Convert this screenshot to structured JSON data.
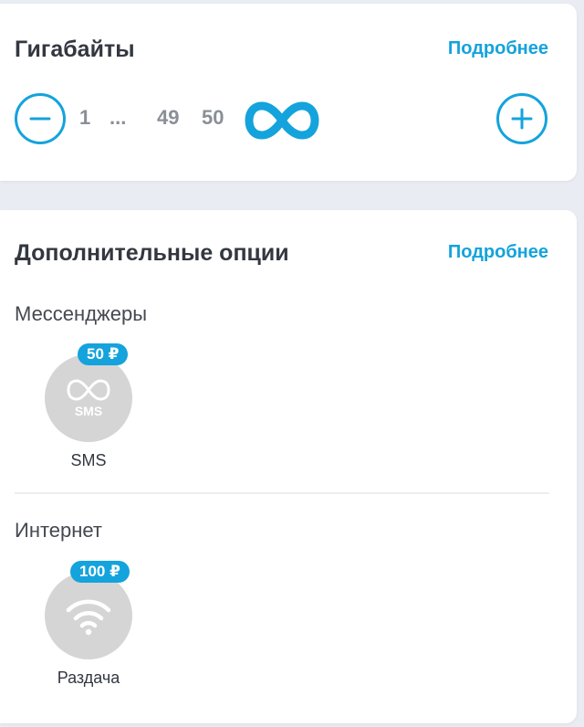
{
  "gigabytes": {
    "title": "Гигабайты",
    "more_link": "Подробнее",
    "values": [
      "1",
      "...",
      "49",
      "50"
    ],
    "unlimited_icon": "infinity-icon"
  },
  "options": {
    "title": "Дополнительные опции",
    "more_link": "Подробнее",
    "messengers": {
      "label": "Мессенджеры",
      "item": {
        "price": "50 ₽",
        "icon_text": "SMS",
        "label": "SMS",
        "icon": "infinity-sms-icon"
      }
    },
    "internet": {
      "label": "Интернет",
      "item": {
        "price": "100 ₽",
        "label": "Раздача",
        "icon": "wifi-icon"
      }
    }
  },
  "colors": {
    "accent": "#14a3dc",
    "text": "#333740",
    "muted": "#8a8f97",
    "inactive_circle": "#d5d5d5"
  }
}
